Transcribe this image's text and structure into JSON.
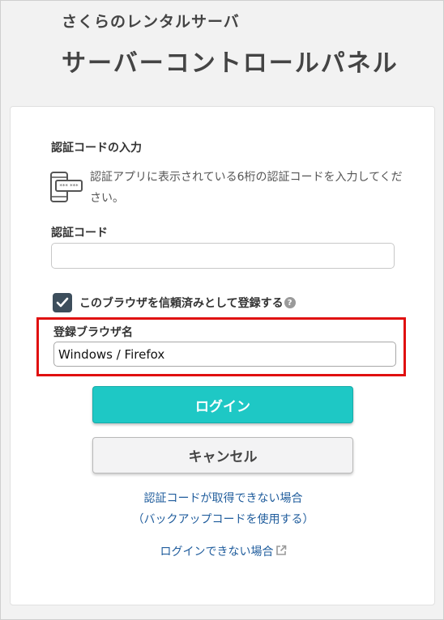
{
  "header": {
    "brand_sub": "さくらのレンタルサーバ",
    "brand_title": "サーバーコントロールパネル"
  },
  "form": {
    "section_title": "認証コードの入力",
    "instruction": "認証アプリに表示されている6桁の認証コードを入力してください。",
    "code_label": "認証コード",
    "code_value": "",
    "trust_label": "このブラウザを信頼済みとして登録する",
    "trust_checked": true,
    "browser_label": "登録ブラウザ名",
    "browser_value": "Windows / Firefox",
    "login_label": "ログイン",
    "cancel_label": "キャンセル"
  },
  "links": {
    "no_code_line1": "認証コードが取得できない場合",
    "no_code_line2": "（バックアップコードを使用する）",
    "cannot_login": "ログインできない場合"
  },
  "icons": {
    "device": "phone-code-icon",
    "checkbox": "check-icon",
    "help": "question-circle-icon",
    "external": "external-link-icon"
  },
  "colors": {
    "primary": "#1ec8c5",
    "link": "#1f5c9c",
    "highlight": "#e01010",
    "checkbox": "#3d4e5c"
  }
}
